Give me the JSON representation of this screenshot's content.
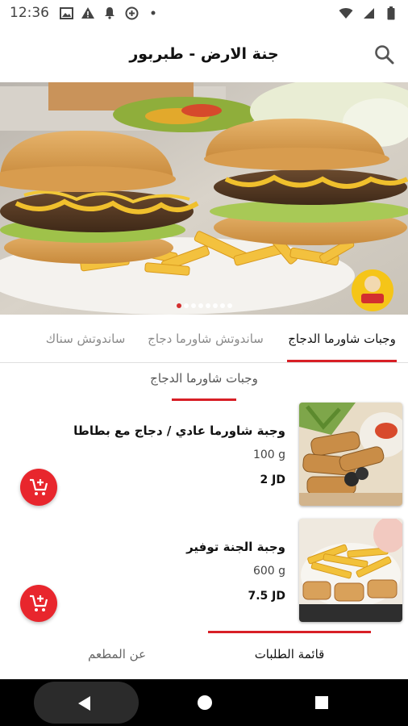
{
  "status_bar": {
    "time": "12:36",
    "left_icons": [
      "gallery-icon",
      "alert-icon",
      "notification-bell-icon",
      "data-saver-icon",
      "dot-icon"
    ],
    "right_icons": [
      "wifi-icon",
      "signal-icon",
      "battery-icon"
    ]
  },
  "app_bar": {
    "title": "جنة الارض - طبربور",
    "search_icon": "search-icon"
  },
  "hero": {
    "slide_count": 8,
    "active_slide": 1,
    "logo_text": "مطاعم جنة الارض"
  },
  "tabs": [
    {
      "label": "وجبات شاورما الدجاج",
      "active": true
    },
    {
      "label": "ساندوتش شاورما دجاج",
      "active": false
    },
    {
      "label": "ساندوتش سناك",
      "active": false
    }
  ],
  "section": {
    "title": "وجبات شاورما الدجاج"
  },
  "products": [
    {
      "name": "وجبة شاورما عادي / دجاج مع بطاطا",
      "weight": "100 g",
      "price": "2 JD"
    },
    {
      "name": "وجبة الجنة توفير",
      "weight": "600 g",
      "price": "7.5 JD"
    }
  ],
  "bottom_tabs": [
    {
      "label": "قائمة الطلبات",
      "active": true
    },
    {
      "label": "عن المطعم",
      "active": false
    }
  ],
  "colors": {
    "accent": "#d81f26",
    "add_button": "#e8262d",
    "nav_background": "#000000"
  }
}
